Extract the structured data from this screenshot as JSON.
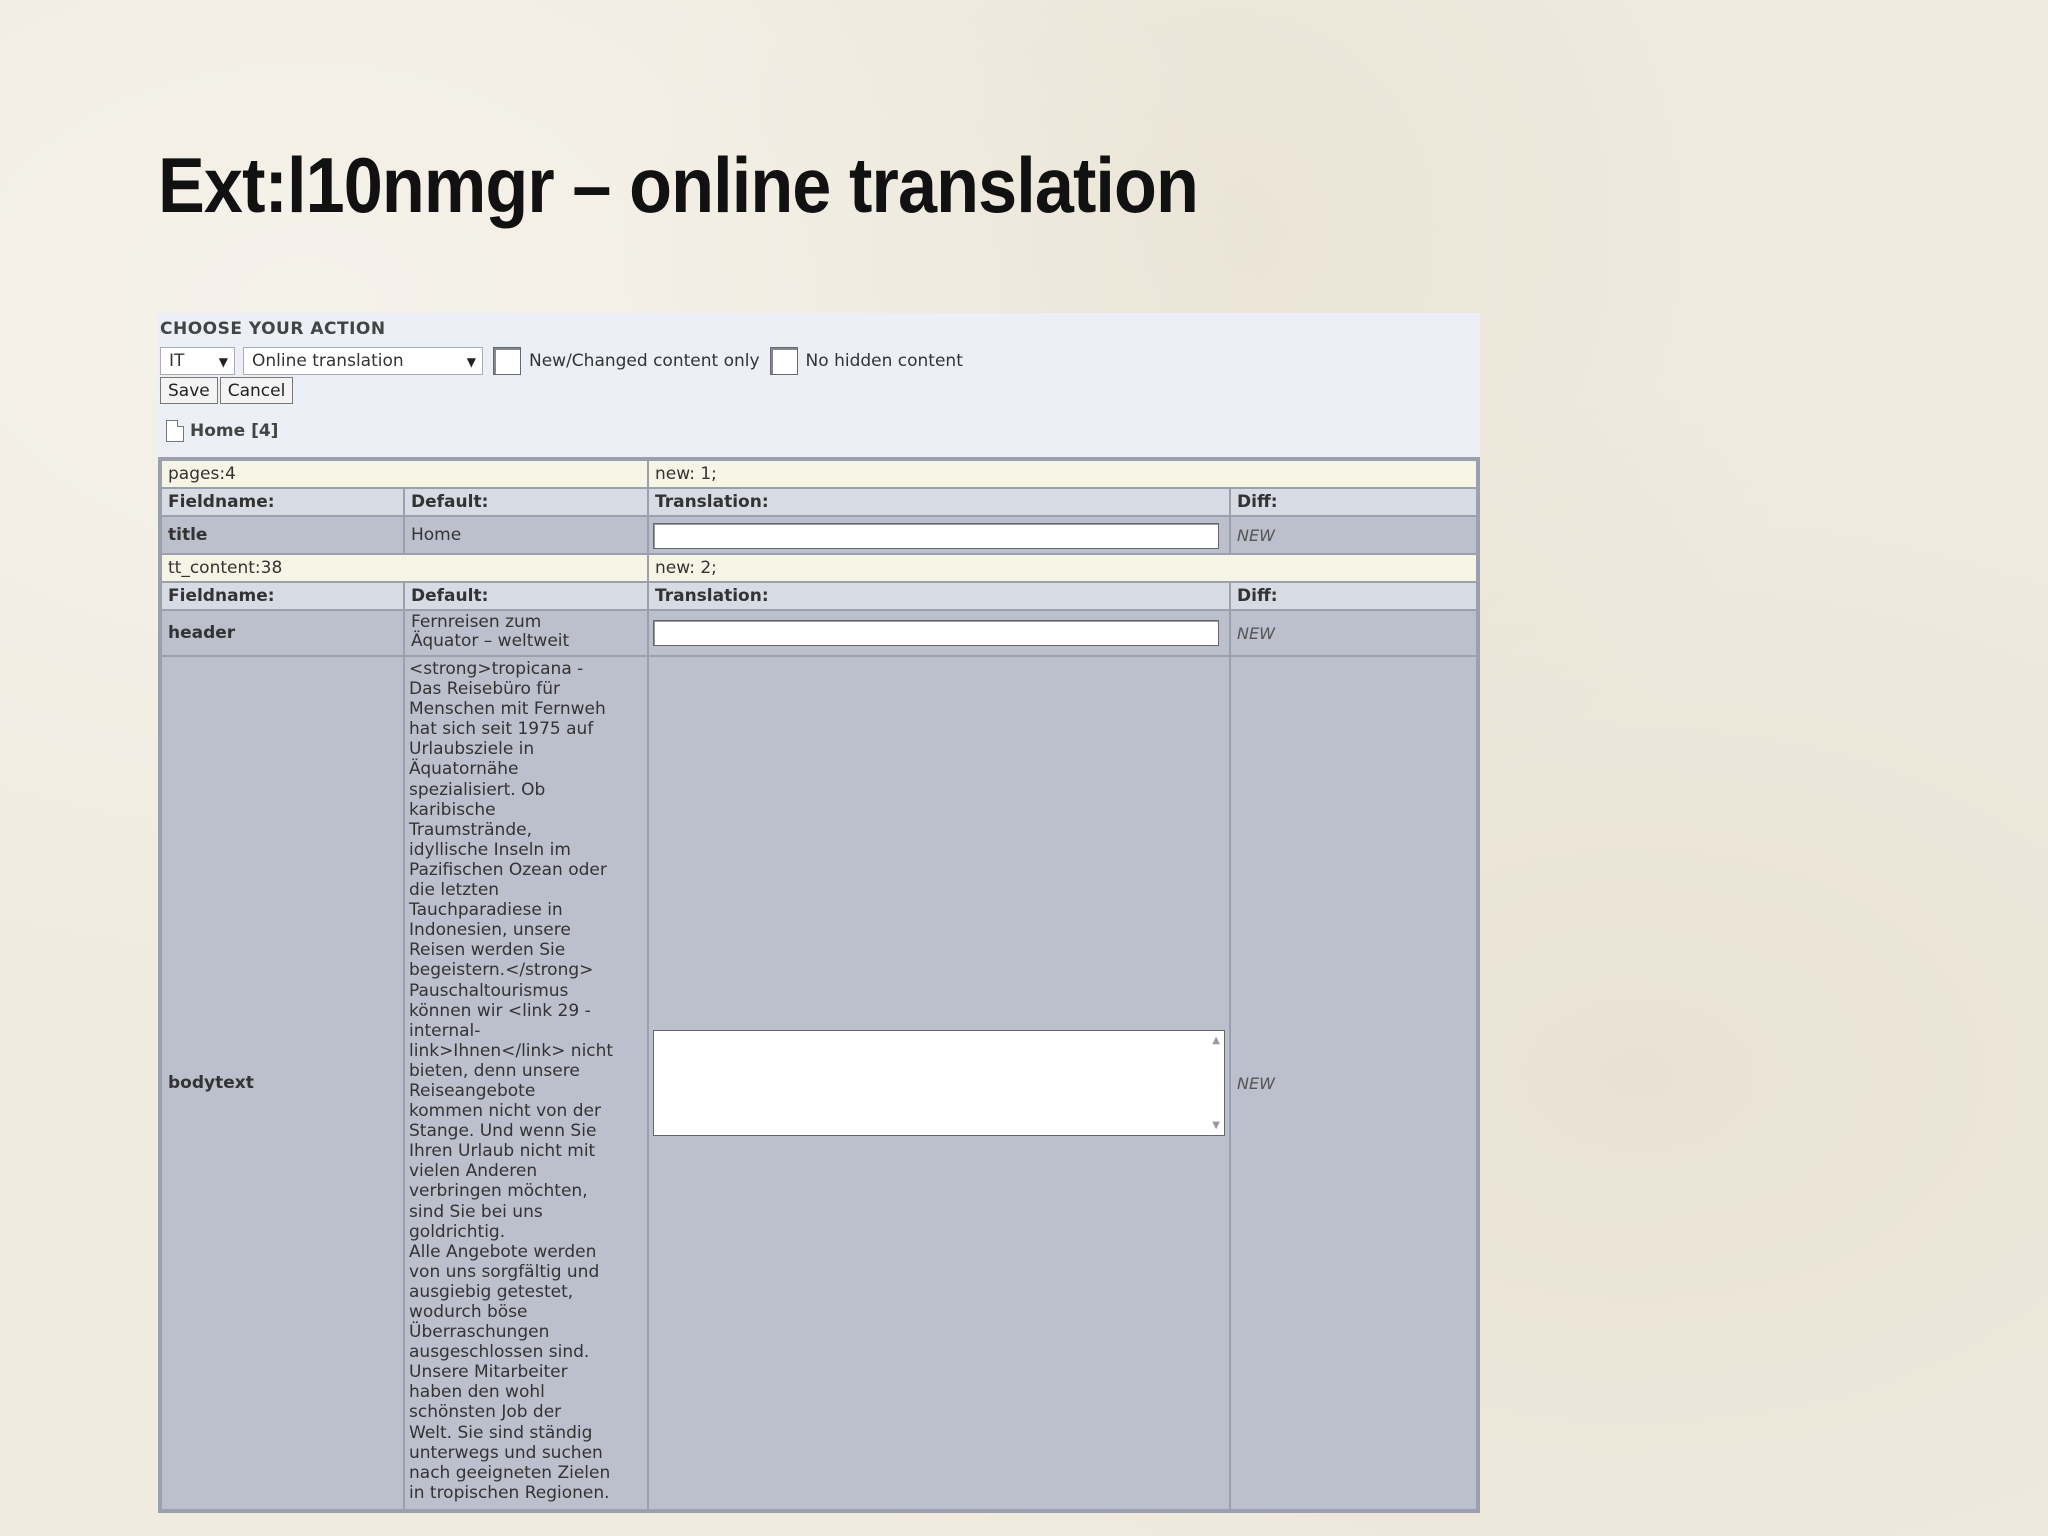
{
  "slide": {
    "title": "Ext:l10nmgr – online translation"
  },
  "action": {
    "heading": "CHOOSE YOUR ACTION",
    "language_select": "IT",
    "mode_select": "Online translation",
    "new_changed_label": "New/Changed content only",
    "no_hidden_label": "No hidden content",
    "save_label": "Save",
    "cancel_label": "Cancel",
    "page_label": "Home [4]"
  },
  "table": {
    "headers": {
      "fieldname": "Fieldname:",
      "default": "Default:",
      "translation": "Translation:",
      "diff": "Diff:"
    },
    "records": [
      {
        "record": "pages:4",
        "status": "new: 1;",
        "fields": [
          {
            "name": "title",
            "default": "Home",
            "diff": "NEW"
          }
        ]
      },
      {
        "record": "tt_content:38",
        "status": "new: 2;",
        "fields": [
          {
            "name": "header",
            "default": "Fernreisen zum\nÄquator – weltweit",
            "diff": "NEW"
          },
          {
            "name": "bodytext",
            "default": "<strong>tropicana -\nDas Reisebüro für\nMenschen mit Fernweh\nhat sich seit 1975 auf\nUrlaubsziele in\nÄquatornähe\nspezialisiert. Ob\nkaribische\nTraumstrände,\nidyllische Inseln im\nPazifischen Ozean oder\ndie letzten\nTauchparadiese in\nIndonesien, unsere\nReisen werden Sie\nbegeistern.</strong>\nPauschaltourismus\nkönnen wir <link 29 -\ninternal-\nlink>Ihnen</link> nicht\nbieten, denn unsere\nReiseangebote\nkommen nicht von der\nStange. Und wenn Sie\nIhren Urlaub nicht mit\nvielen Anderen\nverbringen möchten,\nsind Sie bei uns\ngoldrichtig.\nAlle Angebote werden\nvon uns sorgfältig und\nausgiebig getestet,\nwodurch böse\nÜberraschungen\nausgeschlossen sind.\nUnsere Mitarbeiter\nhaben den wohl\nschönsten Job der\nWelt. Sie sind ständig\nunterwegs und suchen\nnach geeigneten Zielen\nin tropischen Regionen.",
            "diff": "NEW"
          }
        ]
      }
    ]
  }
}
